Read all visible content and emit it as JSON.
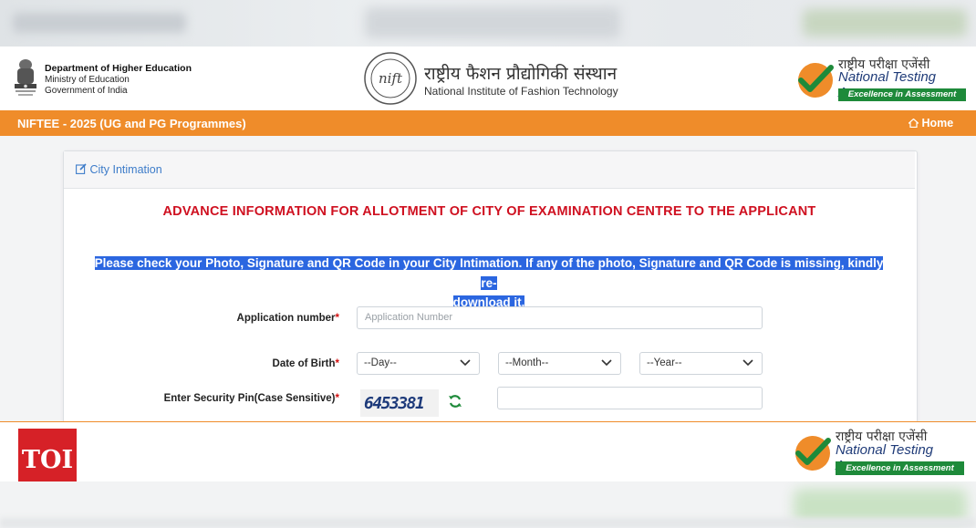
{
  "header": {
    "dept_title": "Department of Higher Education",
    "dept_line2": "Ministry of Education",
    "dept_line3": "Government of India",
    "nift_logo_text": "nift",
    "nift_hindi": "राष्ट्रीय फैशन प्रौद्योगिकी संस्थान",
    "nift_english": "National Institute of Fashion Technology",
    "nta_hindi": "राष्ट्रीय परीक्षा एजेंसी",
    "nta_english": "National Testing Agency",
    "nta_tagline": "Excellence in Assessment"
  },
  "navbar": {
    "title": "NIFTEE - 2025 (UG and PG Programmes)",
    "home_label": "Home"
  },
  "card": {
    "title": "City Intimation",
    "heading": "ADVANCE INFORMATION FOR ALLOTMENT OF CITY OF EXAMINATION CENTRE TO THE APPLICANT",
    "notice_line1": "Please check your Photo, Signature and QR Code in your City Intimation. If any of the photo, Signature and QR Code is missing, kindly re-",
    "notice_line2": "download it."
  },
  "form": {
    "application_label": "Application number",
    "application_placeholder": "Application Number",
    "application_value": "",
    "dob_label": "Date of Birth",
    "day_selected": "--Day--",
    "month_selected": "--Month--",
    "year_selected": "--Year--",
    "pin_label": "Enter Security Pin(Case Sensitive)",
    "required_mark": "*",
    "captcha_text": "6453381",
    "pin_value": ""
  },
  "overlay": {
    "brand": "TOI",
    "nta_hindi": "राष्ट्रीय परीक्षा एजेंसी",
    "nta_english": "National Testing Agency",
    "nta_tagline": "Excellence in Assessment"
  },
  "colors": {
    "orange_bar": "#ef8c2a",
    "heading_red": "#cf1020",
    "link_blue": "#3d7cc9",
    "highlight_blue": "#2b66e0",
    "nta_green": "#1e8a3a",
    "toi_red": "#d62127"
  },
  "icons": {
    "emblem": "national-emblem-icon",
    "edit": "edit-icon",
    "home": "home-icon",
    "refresh": "refresh-icon",
    "chevron": "chevron-down-icon",
    "check": "nta-check-icon"
  }
}
